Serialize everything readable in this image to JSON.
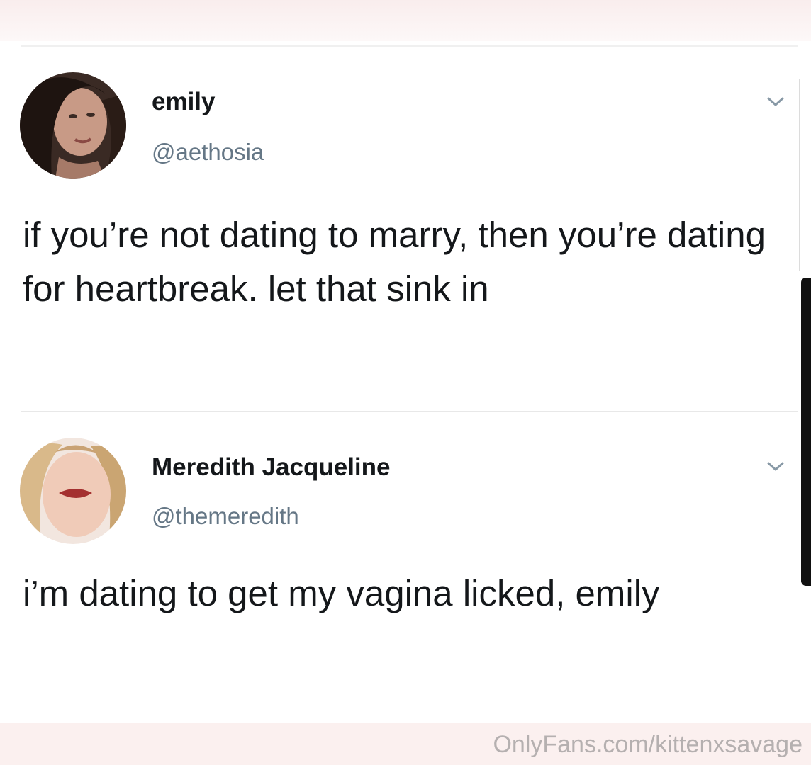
{
  "tweets": [
    {
      "display_name": "emily",
      "handle": "@aethosia",
      "text": "if you’re not dating to marry, then you’re dating for heartbreak. let that sink in"
    },
    {
      "display_name": "Meredith Jacqueline",
      "handle": "@themeredith",
      "text": "i’m dating to get my vagina licked, emily"
    }
  ],
  "watermark": "OnlyFans.com/kittenxsavage",
  "icons": {
    "menu": "chevron-down-icon"
  },
  "colors": {
    "text": "#14171a",
    "handle": "#657786",
    "background": "#ffffff"
  }
}
